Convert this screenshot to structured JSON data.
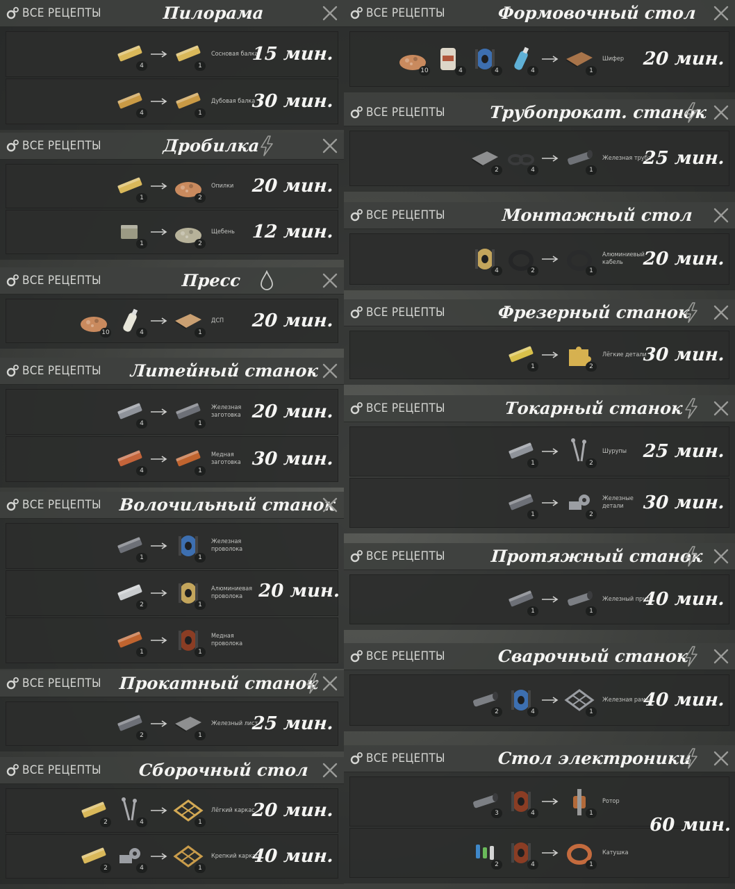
{
  "ui": {
    "all_recipes_label": "ВСЕ РЕЦЕПТЫ"
  },
  "left": [
    {
      "title": "Пилорама",
      "icon": "none",
      "recipes": [
        {
          "inputs": [
            {
              "item": "wood-beam",
              "qty": "4"
            }
          ],
          "outputs": [
            {
              "item": "wood-beam",
              "qty": "1"
            }
          ],
          "product": "Сосновая балка",
          "time": "15 мин."
        },
        {
          "inputs": [
            {
              "item": "wood-beam-dark",
              "qty": "4"
            }
          ],
          "outputs": [
            {
              "item": "wood-beam-dark",
              "qty": "1"
            }
          ],
          "product": "Дубовая балка",
          "time": "30 мин."
        }
      ]
    },
    {
      "title": "Дробилка",
      "icon": "bolt",
      "recipes": [
        {
          "inputs": [
            {
              "item": "wood-beam",
              "qty": "1"
            }
          ],
          "outputs": [
            {
              "item": "sawdust",
              "qty": "2"
            }
          ],
          "product": "Опилки",
          "time": "20 мин."
        },
        {
          "inputs": [
            {
              "item": "stone-block",
              "qty": "1"
            }
          ],
          "outputs": [
            {
              "item": "gravel",
              "qty": "2"
            }
          ],
          "product": "Щебень",
          "time": "12 мин."
        }
      ]
    },
    {
      "title": "Пресс",
      "icon": "drop",
      "recipes": [
        {
          "inputs": [
            {
              "item": "sawdust",
              "qty": "10"
            },
            {
              "item": "glue",
              "qty": "4"
            }
          ],
          "outputs": [
            {
              "item": "chipboard",
              "qty": "1"
            }
          ],
          "product": "ДСП",
          "time": "20 мин."
        }
      ]
    },
    {
      "title": "Литейный станок",
      "icon": "none",
      "recipes": [
        {
          "inputs": [
            {
              "item": "iron-ingot",
              "qty": "4"
            }
          ],
          "outputs": [
            {
              "item": "iron-billet",
              "qty": "1"
            }
          ],
          "product": "Железная заготовка",
          "time": "20 мин."
        },
        {
          "inputs": [
            {
              "item": "copper-ingot",
              "qty": "4"
            }
          ],
          "outputs": [
            {
              "item": "copper-billet",
              "qty": "1"
            }
          ],
          "product": "Медная заготовка",
          "time": "30 мин."
        }
      ]
    },
    {
      "title": "Волочильный станок",
      "icon": "none",
      "merged_time": "20 мин.",
      "recipes": [
        {
          "inputs": [
            {
              "item": "iron-billet",
              "qty": "1"
            }
          ],
          "outputs": [
            {
              "item": "iron-wire",
              "qty": "1"
            }
          ],
          "product": "Железная проволока",
          "time": ""
        },
        {
          "inputs": [
            {
              "item": "aluminium-ingot",
              "qty": "2"
            }
          ],
          "outputs": [
            {
              "item": "aluminium-wire",
              "qty": "1"
            }
          ],
          "product": "Алюминиевая проволока",
          "time": ""
        },
        {
          "inputs": [
            {
              "item": "copper-billet",
              "qty": "1"
            }
          ],
          "outputs": [
            {
              "item": "copper-wire",
              "qty": "1"
            }
          ],
          "product": "Медная проволока",
          "time": ""
        }
      ]
    },
    {
      "title": "Прокатный станок",
      "icon": "bolt",
      "recipes": [
        {
          "inputs": [
            {
              "item": "iron-billet",
              "qty": "2"
            }
          ],
          "outputs": [
            {
              "item": "iron-sheet",
              "qty": "1"
            }
          ],
          "product": "Железный лист",
          "time": "25 мин."
        }
      ]
    },
    {
      "title": "Сборочный стол",
      "icon": "none",
      "recipes": [
        {
          "inputs": [
            {
              "item": "wood-beam",
              "qty": "2"
            },
            {
              "item": "screws",
              "qty": "4"
            }
          ],
          "outputs": [
            {
              "item": "light-frame",
              "qty": "1"
            }
          ],
          "product": "Лёгкий каркас",
          "time": "20 мин."
        },
        {
          "inputs": [
            {
              "item": "wood-beam",
              "qty": "2"
            },
            {
              "item": "iron-parts",
              "qty": "4"
            }
          ],
          "outputs": [
            {
              "item": "strong-frame",
              "qty": "1"
            }
          ],
          "product": "Крепкий каркас",
          "time": "40 мин."
        }
      ]
    }
  ],
  "right": [
    {
      "title": "Формовочный стол",
      "icon": "none",
      "recipes": [
        {
          "inputs": [
            {
              "item": "sawdust",
              "qty": "10"
            },
            {
              "item": "cement",
              "qty": "4"
            },
            {
              "item": "iron-wire",
              "qty": "4"
            },
            {
              "item": "bottle",
              "qty": "4"
            }
          ],
          "outputs": [
            {
              "item": "slate",
              "qty": "1"
            }
          ],
          "product": "Шифер",
          "time": "20 мин."
        }
      ]
    },
    {
      "title": "Трубопрокат. станок",
      "icon": "bolt",
      "recipes": [
        {
          "inputs": [
            {
              "item": "iron-sheet",
              "qty": "2"
            },
            {
              "item": "rings",
              "qty": "4"
            }
          ],
          "outputs": [
            {
              "item": "iron-pipe",
              "qty": "1"
            }
          ],
          "product": "Железная труба",
          "time": "25 мин."
        }
      ]
    },
    {
      "title": "Монтажный стол",
      "icon": "none",
      "recipes": [
        {
          "inputs": [
            {
              "item": "aluminium-wire",
              "qty": "4"
            },
            {
              "item": "rubber",
              "qty": "2"
            }
          ],
          "outputs": [
            {
              "item": "aluminium-cable",
              "qty": "1"
            }
          ],
          "product": "Алюминиевый кабель",
          "time": "20 мин."
        }
      ]
    },
    {
      "title": "Фрезерный станок",
      "icon": "bolt",
      "recipes": [
        {
          "inputs": [
            {
              "item": "brass-bar",
              "qty": "1"
            }
          ],
          "outputs": [
            {
              "item": "light-parts",
              "qty": "2"
            }
          ],
          "product": "Лёгкие детали",
          "time": "30 мин."
        }
      ]
    },
    {
      "title": "Токарный станок",
      "icon": "bolt",
      "recipes": [
        {
          "inputs": [
            {
              "item": "iron-ingot",
              "qty": "1"
            }
          ],
          "outputs": [
            {
              "item": "screws",
              "qty": "2"
            }
          ],
          "product": "Шурупы",
          "time": "25 мин."
        },
        {
          "inputs": [
            {
              "item": "iron-billet",
              "qty": "1"
            }
          ],
          "outputs": [
            {
              "item": "iron-parts",
              "qty": "2"
            }
          ],
          "product": "Железные детали",
          "time": "30 мин."
        }
      ]
    },
    {
      "title": "Протяжный станок",
      "icon": "bolt",
      "recipes": [
        {
          "inputs": [
            {
              "item": "iron-billet",
              "qty": "1"
            }
          ],
          "outputs": [
            {
              "item": "iron-rod",
              "qty": "1"
            }
          ],
          "product": "Железный прут",
          "time": "40 мин."
        }
      ]
    },
    {
      "title": "Сварочный станок",
      "icon": "bolt",
      "recipes": [
        {
          "inputs": [
            {
              "item": "iron-rod",
              "qty": "2"
            },
            {
              "item": "iron-wire",
              "qty": "4"
            }
          ],
          "outputs": [
            {
              "item": "iron-frame",
              "qty": "1"
            }
          ],
          "product": "Железная рама",
          "time": "40 мин."
        }
      ]
    },
    {
      "title": "Стол электроники",
      "icon": "bolt",
      "merged_time": "60 мин.",
      "recipes": [
        {
          "inputs": [
            {
              "item": "iron-rod",
              "qty": "3"
            },
            {
              "item": "copper-wire",
              "qty": "4"
            }
          ],
          "outputs": [
            {
              "item": "rotor",
              "qty": "1"
            }
          ],
          "product": "Ротор",
          "time": ""
        },
        {
          "inputs": [
            {
              "item": "components",
              "qty": "2"
            },
            {
              "item": "copper-wire",
              "qty": "4"
            }
          ],
          "outputs": [
            {
              "item": "coil",
              "qty": "1"
            }
          ],
          "product": "Катушка",
          "time": ""
        }
      ]
    }
  ],
  "item_colors": {
    "wood-beam": "#d9b85a",
    "wood-beam-dark": "#c99a45",
    "sawdust": "#c98a5e",
    "gravel": "#b7b29a",
    "stone-block": "#9b9a84",
    "glue": "#e8e6da",
    "chipboard": "#caa072",
    "iron-ingot": "#8f939a",
    "copper-ingot": "#c4643a",
    "iron-billet": "#6d7077",
    "copper-billet": "#c0642f",
    "iron-wire": "#3d6fb0",
    "aluminium-ingot": "#c9ccce",
    "aluminium-wire": "#c3a55c",
    "copper-wire": "#8a3d24",
    "iron-sheet": "#8e8f90",
    "screws": "#a9aaad",
    "light-frame": "#d3a954",
    "iron-parts": "#9b9ea3",
    "strong-frame": "#c99c4b",
    "cement": "#ddd6c8",
    "bottle": "#5fb0d6",
    "slate": "#a8744a",
    "rings": "#3a3b3c",
    "iron-pipe": "#6f7277",
    "rubber": "#252627",
    "aluminium-cable": "#2a2b2c",
    "brass-bar": "#d8c04a",
    "light-parts": "#d6b150",
    "iron-rod": "#7c7f84",
    "iron-frame": "#9a9da2",
    "rotor": "#b36a3a",
    "components": "#3f88c9",
    "coil": "#c46b3e"
  }
}
